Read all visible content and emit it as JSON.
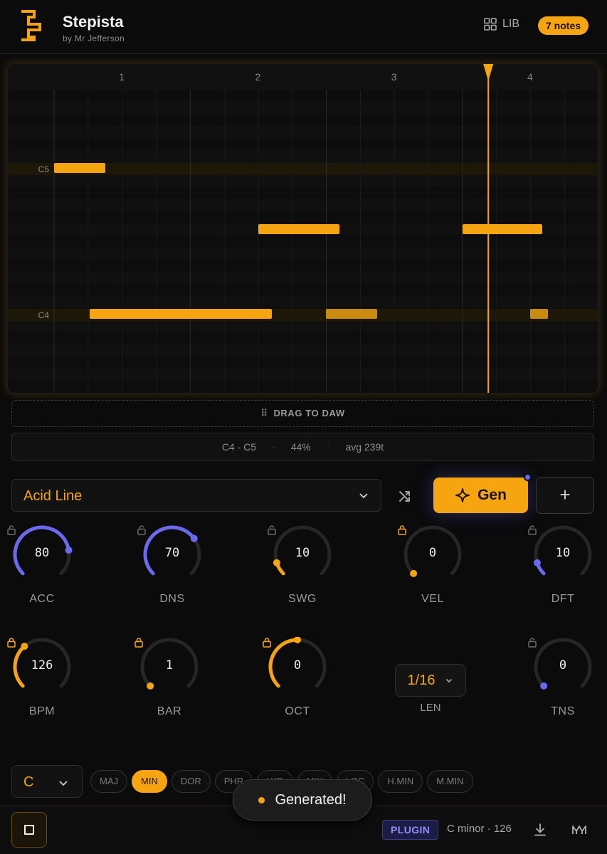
{
  "header": {
    "title": "Stepista",
    "subtitle": "by Mr Jefferson",
    "lib_label": "LIB",
    "notes_badge": "7 notes"
  },
  "piano_roll": {
    "bar_labels": [
      "1",
      "2",
      "3",
      "4"
    ],
    "row_labels": [
      "C5",
      "C4"
    ],
    "playhead_bar": 3.2
  },
  "drag_label": "DRAG TO DAW",
  "stats": {
    "range": "C4 - C5",
    "density": "44%",
    "avg": "avg 239t"
  },
  "preset": {
    "label": "Acid Line"
  },
  "gen_label": "Gen",
  "knobs": [
    {
      "id": "acc",
      "value": "80",
      "label": "ACC",
      "level": 0.8,
      "color": "#6a6af0",
      "locked": false
    },
    {
      "id": "dns",
      "value": "70",
      "label": "DNS",
      "level": 0.7,
      "color": "#6a6af0",
      "locked": false
    },
    {
      "id": "swg",
      "value": "10",
      "label": "SWG",
      "level": 0.1,
      "color": "#f6a511",
      "locked": false
    },
    {
      "id": "vel",
      "value": "0",
      "label": "VEL",
      "level": 0.0,
      "color": "#f6a511",
      "locked": true
    },
    {
      "id": "dft",
      "value": "10",
      "label": "DFT",
      "level": 0.1,
      "color": "#6a6af0",
      "locked": false
    },
    {
      "id": "bpm",
      "value": "126",
      "label": "BPM",
      "level": 0.35,
      "color": "#f6a511",
      "locked": true
    },
    {
      "id": "bar",
      "value": "1",
      "label": "BAR",
      "level": 0.0,
      "color": "#f6a511",
      "locked": true
    },
    {
      "id": "oct",
      "value": "0",
      "label": "OCT",
      "level": 0.5,
      "color": "#f6a511",
      "locked": true
    },
    {
      "id": "tns",
      "value": "0",
      "label": "TNS",
      "level": 0.0,
      "color": "#6a6af0",
      "locked": false
    }
  ],
  "len": {
    "value": "1/16",
    "label": "LEN"
  },
  "key": {
    "value": "C"
  },
  "scales": [
    {
      "label": "MAJ",
      "active": false
    },
    {
      "label": "MIN",
      "active": true
    },
    {
      "label": "DOR",
      "active": false
    },
    {
      "label": "PHR",
      "active": false
    },
    {
      "label": "LYD",
      "active": false
    },
    {
      "label": "MIX",
      "active": false
    },
    {
      "label": "LOC",
      "active": false
    },
    {
      "label": "H.MIN",
      "active": false
    },
    {
      "label": "M.MIN",
      "active": false
    }
  ],
  "footer": {
    "plugin_label": "PLUGIN",
    "scale_info": "C minor · 126"
  },
  "toast": {
    "message": "Generated!"
  },
  "colors": {
    "accent": "#f6a511",
    "secondary": "#6a6af0",
    "background": "#0b0b0c"
  }
}
